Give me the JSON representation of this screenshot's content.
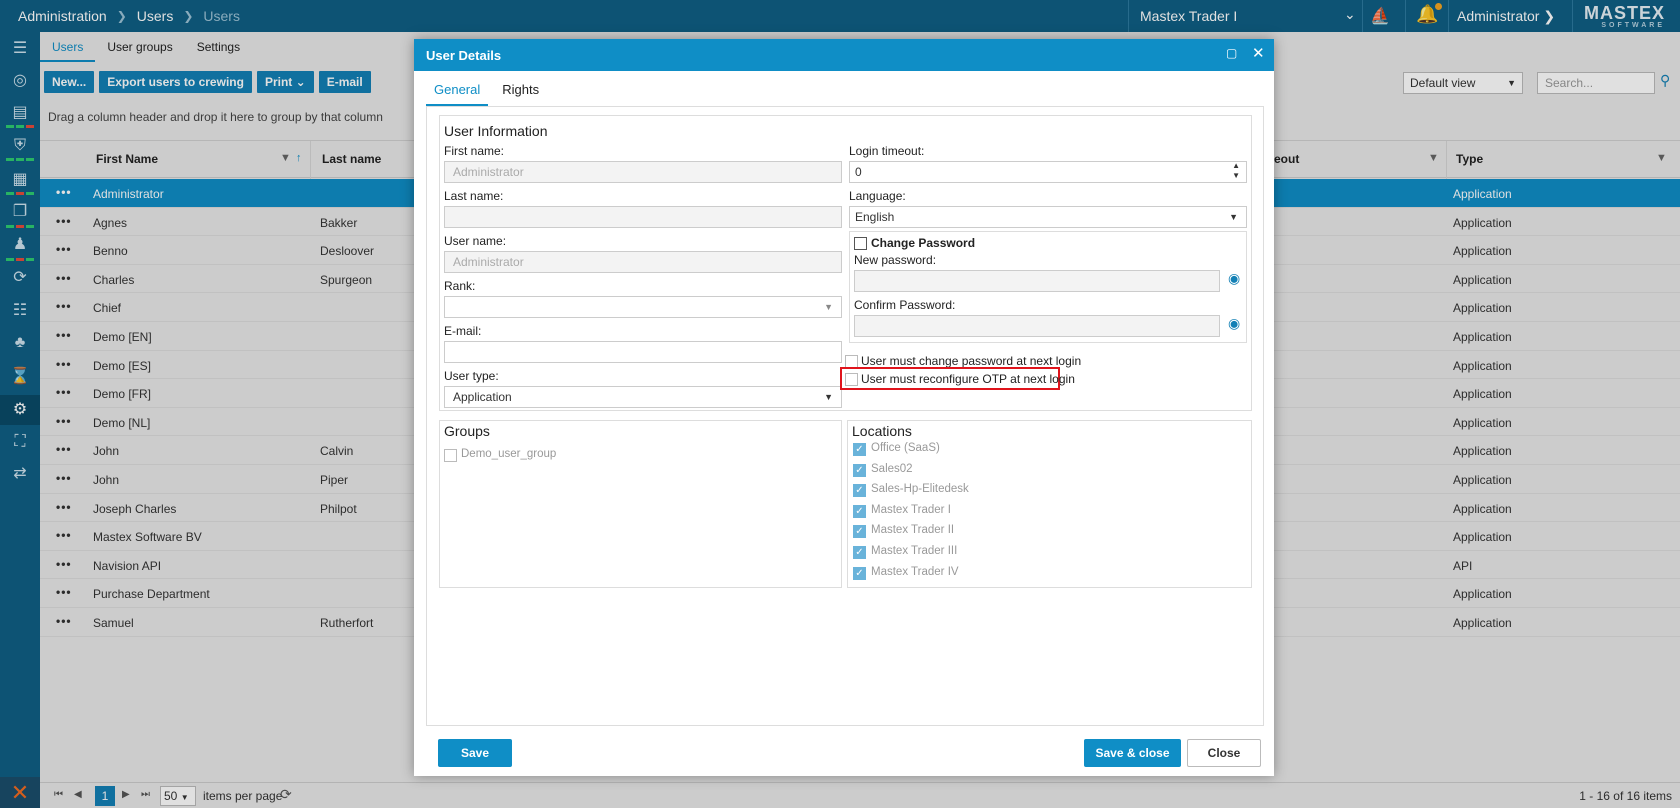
{
  "header": {
    "breadcrumb": [
      "Administration",
      "Users",
      "Users"
    ],
    "vessel": "Mastex Trader I",
    "user": "Administrator",
    "logo": "MASTEX",
    "logo_sub": "SOFTWARE"
  },
  "subtabs": [
    "Users",
    "User groups",
    "Settings"
  ],
  "toolbar": {
    "new": "New...",
    "export": "Export users to crewing",
    "print": "Print",
    "email": "E-mail",
    "view": "Default view",
    "search_placeholder": "Search..."
  },
  "grid": {
    "group_hint": "Drag a column header and drop it here to group by that column",
    "columns": [
      "First Name",
      "Last name",
      "eout",
      "Type"
    ],
    "rows": [
      {
        "first": "Administrator",
        "last": "",
        "type": "Application"
      },
      {
        "first": "Agnes",
        "last": "Bakker",
        "type": "Application"
      },
      {
        "first": "Benno",
        "last": "Desloover",
        "type": "Application"
      },
      {
        "first": "Charles",
        "last": "Spurgeon",
        "type": "Application"
      },
      {
        "first": "Chief",
        "last": "",
        "type": "Application"
      },
      {
        "first": "Demo [EN]",
        "last": "",
        "type": "Application"
      },
      {
        "first": "Demo [ES]",
        "last": "",
        "type": "Application"
      },
      {
        "first": "Demo [FR]",
        "last": "",
        "type": "Application"
      },
      {
        "first": "Demo [NL]",
        "last": "",
        "type": "Application"
      },
      {
        "first": "John",
        "last": "Calvin",
        "type": "Application"
      },
      {
        "first": "John",
        "last": "Piper",
        "type": "Application"
      },
      {
        "first": "Joseph Charles",
        "last": "Philpot",
        "type": "Application"
      },
      {
        "first": "Mastex Software BV",
        "last": "",
        "type": "Application"
      },
      {
        "first": "Navision API",
        "last": "",
        "type": "API"
      },
      {
        "first": "Purchase Department",
        "last": "",
        "type": "Application"
      },
      {
        "first": "Samuel",
        "last": "Rutherfort",
        "type": "Application"
      }
    ]
  },
  "pager": {
    "page": "1",
    "page_size": "50",
    "items_per_page": "items per page",
    "count": "1 - 16 of 16 items"
  },
  "dialog": {
    "title": "User Details",
    "tabs": [
      "General",
      "Rights"
    ],
    "user_info": {
      "title": "User Information",
      "first_name_label": "First name:",
      "first_name_placeholder": "Administrator",
      "last_name_label": "Last name:",
      "user_name_label": "User name:",
      "user_name_placeholder": "Administrator",
      "rank_label": "Rank:",
      "email_label": "E-mail:",
      "user_type_label": "User type:",
      "user_type_value": "Application",
      "login_timeout_label": "Login timeout:",
      "login_timeout_value": "0",
      "language_label": "Language:",
      "language_value": "English",
      "change_password": "Change Password",
      "new_password_label": "New password:",
      "confirm_password_label": "Confirm Password:",
      "must_change_pw": "User must change password at next login",
      "must_reconfigure_otp": "User must reconfigure OTP at next login"
    },
    "groups": {
      "title": "Groups",
      "items": [
        "Demo_user_group"
      ]
    },
    "locations": {
      "title": "Locations",
      "items": [
        "Office (SaaS)",
        "Sales02",
        "Sales-Hp-Elitedesk",
        "Mastex Trader I",
        "Mastex Trader II",
        "Mastex Trader III",
        "Mastex Trader IV"
      ]
    },
    "buttons": {
      "save": "Save",
      "save_close": "Save & close",
      "close": "Close"
    }
  }
}
